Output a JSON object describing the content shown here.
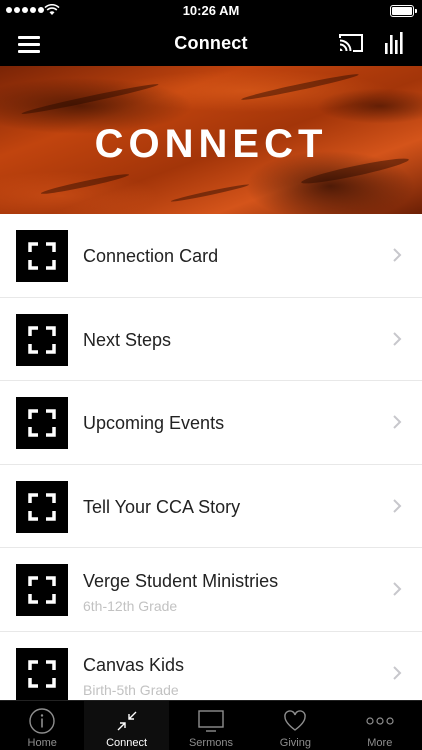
{
  "status_bar": {
    "time": "10:26 AM"
  },
  "nav": {
    "title": "Connect"
  },
  "hero": {
    "title": "CONNECT"
  },
  "list": {
    "items": [
      {
        "label": "Connection Card",
        "sub": ""
      },
      {
        "label": "Next Steps",
        "sub": ""
      },
      {
        "label": "Upcoming Events",
        "sub": ""
      },
      {
        "label": "Tell Your CCA Story",
        "sub": ""
      },
      {
        "label": "Verge Student Ministries",
        "sub": "6th-12th Grade"
      },
      {
        "label": "Canvas Kids",
        "sub": "Birth-5th Grade"
      }
    ]
  },
  "tabs": [
    {
      "label": "Home",
      "icon": "info-icon",
      "active": false
    },
    {
      "label": "Connect",
      "icon": "collapse-arrows-icon",
      "active": true
    },
    {
      "label": "Sermons",
      "icon": "monitor-icon",
      "active": false
    },
    {
      "label": "Giving",
      "icon": "heart-icon",
      "active": false
    },
    {
      "label": "More",
      "icon": "ellipsis-icon",
      "active": false
    }
  ],
  "colors": {
    "accent": "#c1440e",
    "bar": "#000000",
    "tab_inactive": "#8e8e8e"
  }
}
